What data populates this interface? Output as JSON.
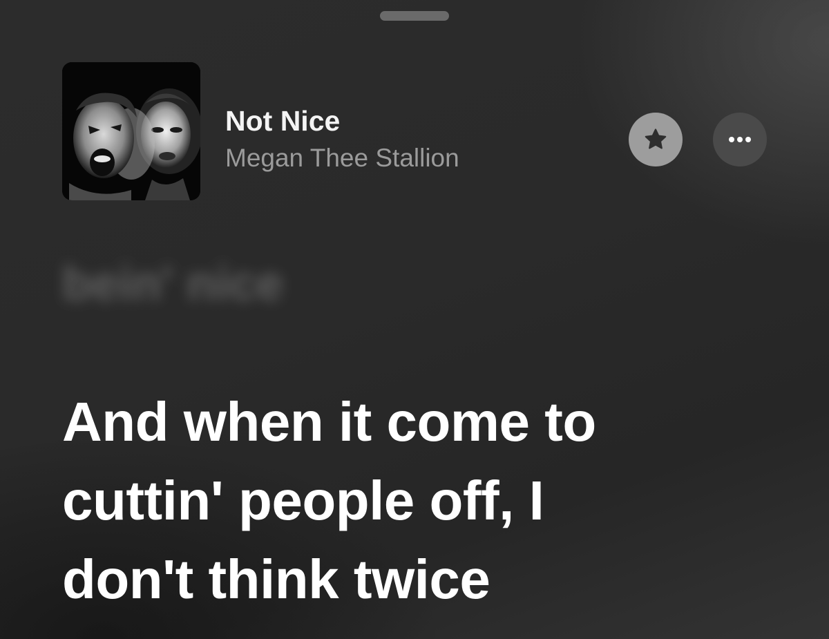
{
  "sheet": {
    "grabber": "sheet-grabber"
  },
  "now_playing": {
    "title": "Not Nice",
    "artist": "Megan Thee Stallion",
    "artwork_icon": "album-artwork",
    "favorite_icon": "star-icon",
    "more_icon": "ellipsis-icon"
  },
  "lyrics": {
    "previous_line": "bein' nice",
    "current_lines": [
      "And when it come to",
      "cuttin' people off, I",
      "don't think twice"
    ]
  },
  "colors": {
    "background": "#2a2a2a",
    "title": "#f4f4f4",
    "artist": "#9b9b9b",
    "favorite_button": "#9d9d9d",
    "more_button": "#4a4a4a",
    "current_lyric": "#ffffff"
  }
}
